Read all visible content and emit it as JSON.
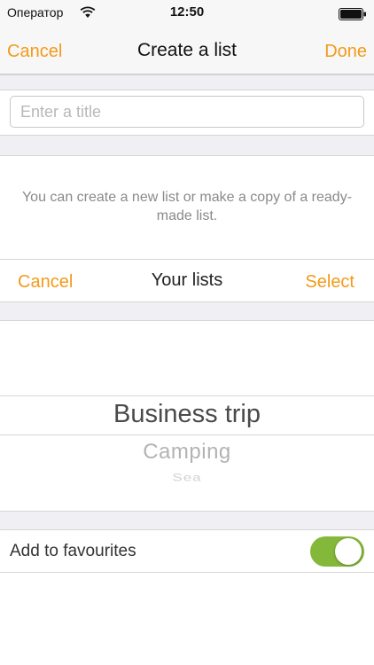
{
  "status_bar": {
    "carrier": "Оператор",
    "time": "12:50"
  },
  "nav": {
    "cancel_label": "Cancel",
    "title": "Create a list",
    "done_label": "Done"
  },
  "title_input": {
    "value": "",
    "placeholder": "Enter a title"
  },
  "info_text": "You can create a new list or make a copy of a ready-made list.",
  "lists_toolbar": {
    "cancel_label": "Cancel",
    "title": "Your lists",
    "select_label": "Select"
  },
  "picker": {
    "selected": "Business trip",
    "options_below": [
      "Camping",
      "Sea"
    ]
  },
  "favourites": {
    "label": "Add to favourites",
    "enabled": true
  },
  "colors": {
    "accent": "#f39a1a",
    "toggle_on": "#84b83a"
  },
  "icons": [
    "wifi-icon",
    "battery-icon"
  ]
}
